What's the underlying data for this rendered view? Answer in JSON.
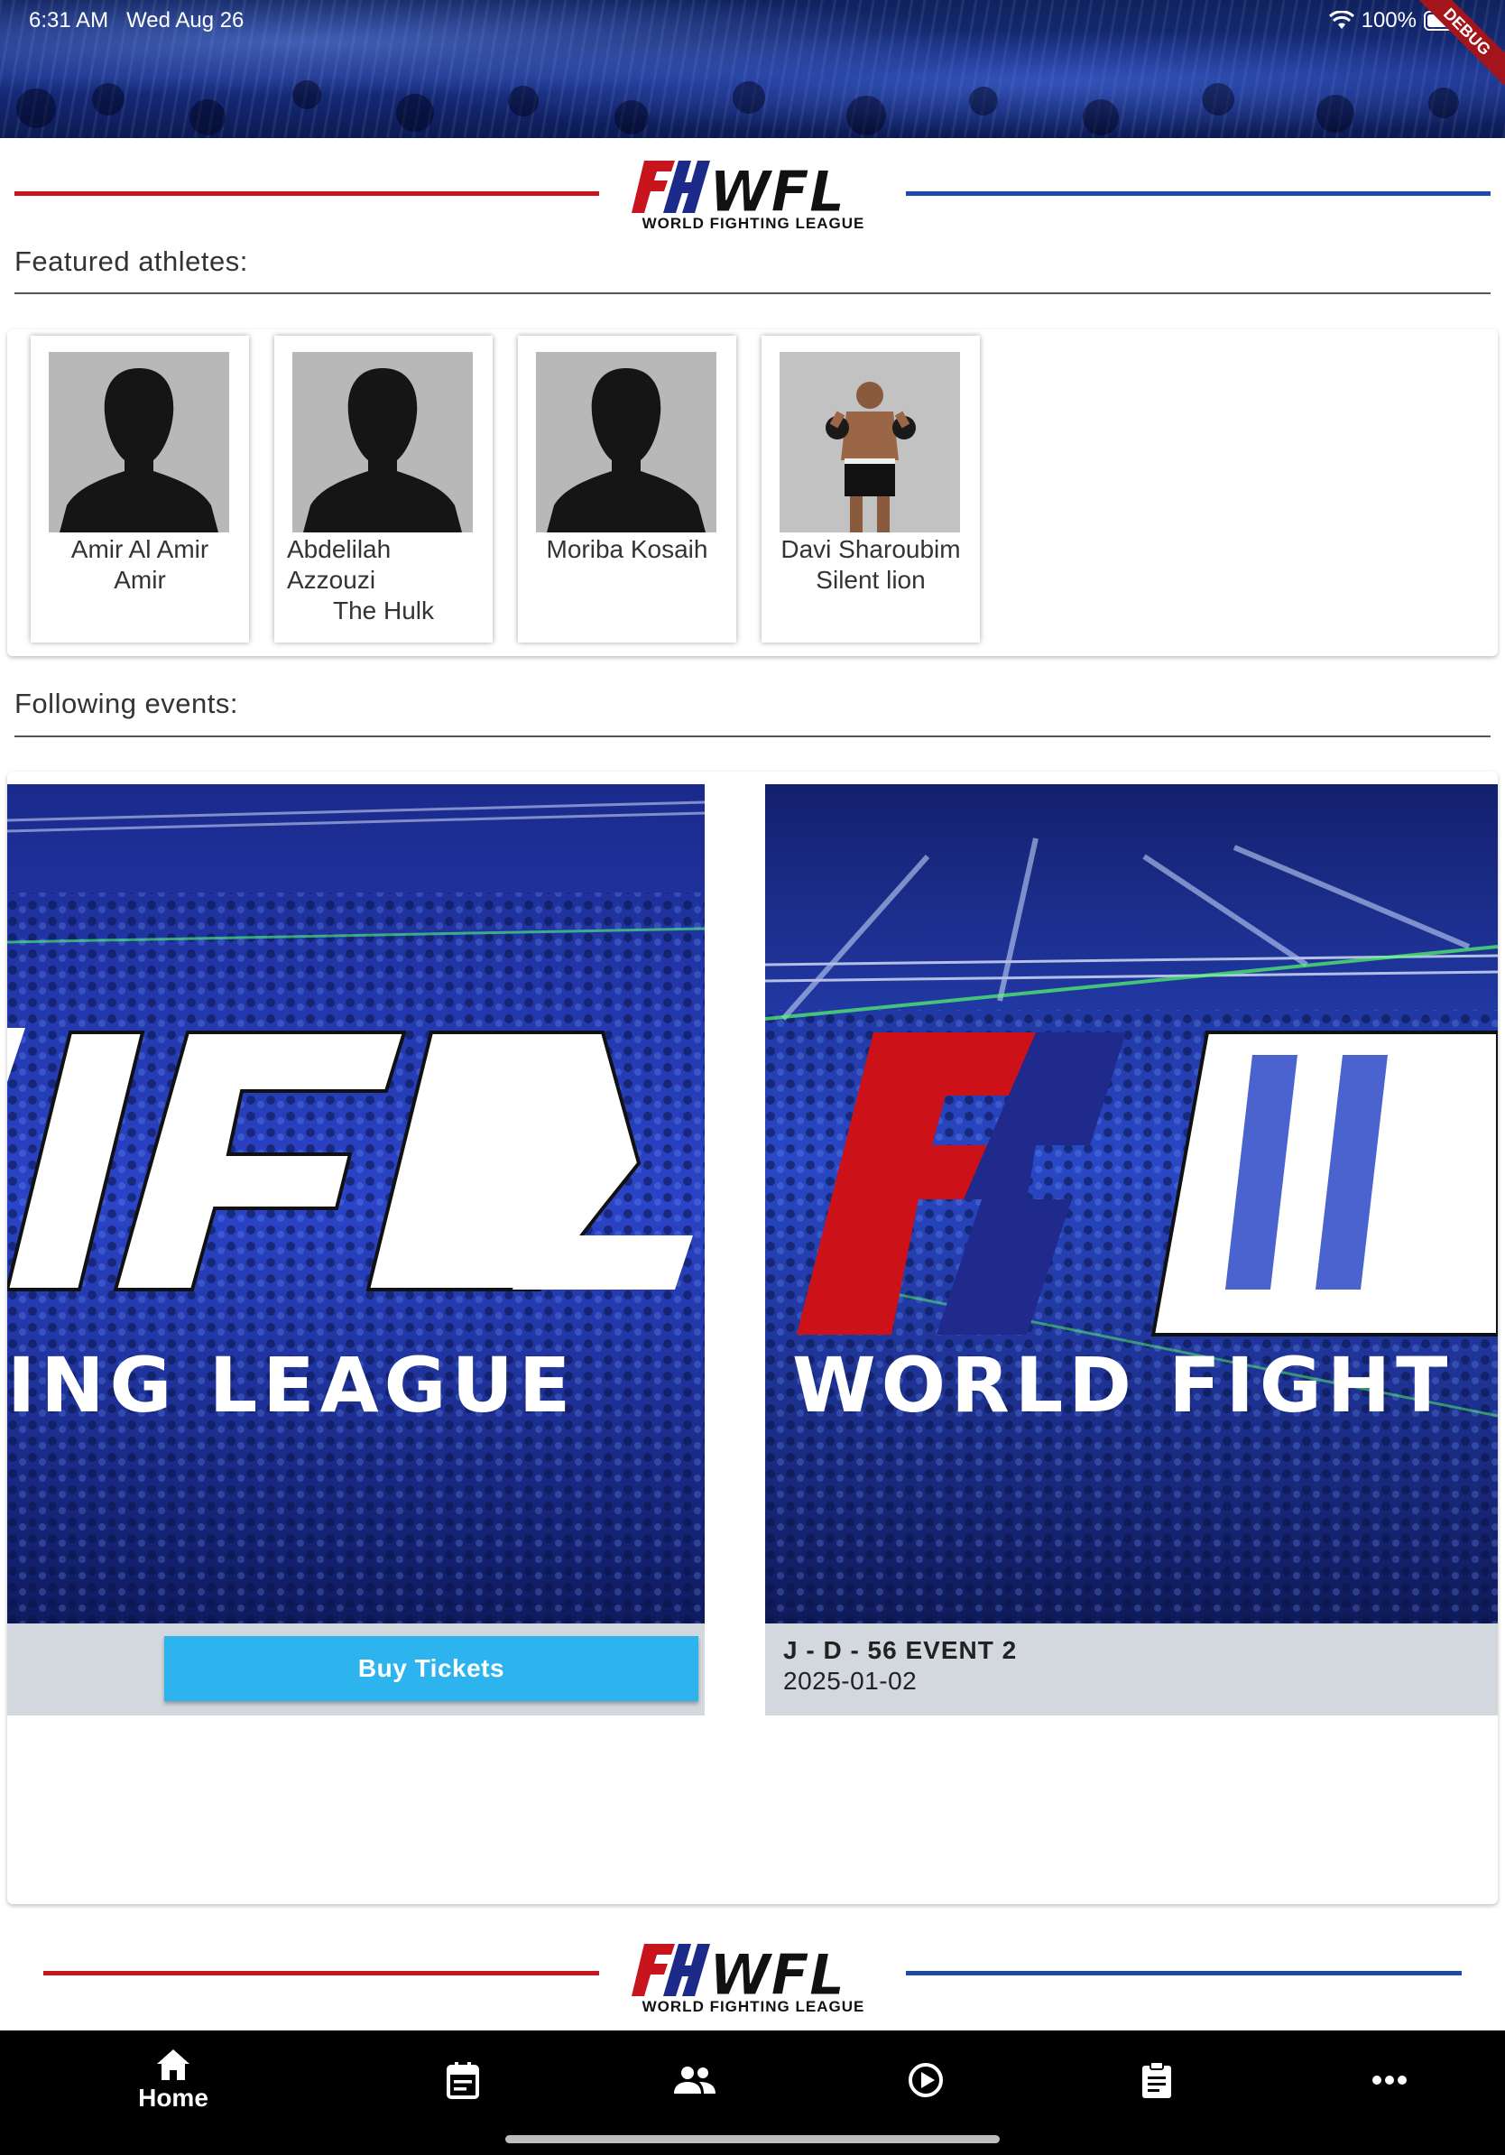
{
  "status_bar": {
    "time": "6:31 AM",
    "date": "Wed Aug 26",
    "battery": "100%",
    "debug_label": "DEBUG"
  },
  "brand": {
    "logo_text": "FHWFL",
    "logo_subtitle": "WORLD FIGHTING LEAGUE",
    "red": "#c8141c",
    "blue": "#1c4aa8"
  },
  "featured": {
    "title": "Featured athletes:",
    "athletes": [
      {
        "name": "Amir Al Amir Amir",
        "nickname": "",
        "photo": "silhouette"
      },
      {
        "name": "Abdelilah Azzouzi",
        "nickname": "The Hulk",
        "photo": "silhouette"
      },
      {
        "name": "Moriba Kosaih",
        "nickname": "",
        "photo": "silhouette"
      },
      {
        "name": "Davi Sharoubim",
        "nickname": "Silent lion",
        "photo": "fighter-photo"
      }
    ]
  },
  "events": {
    "title": "Following events:",
    "items": [
      {
        "button_label": "Buy Tickets"
      },
      {
        "name": "J - D - 56 EVENT 2",
        "date": "2025-01-02"
      }
    ],
    "poster_left_text": "ING LEAGUE",
    "poster_right_text": "WORLD FIGHT"
  },
  "nav": {
    "items": [
      {
        "label": "Home",
        "icon": "home-icon",
        "active": true
      },
      {
        "label": "",
        "icon": "calendar-icon"
      },
      {
        "label": "",
        "icon": "people-icon"
      },
      {
        "label": "",
        "icon": "play-circle-icon"
      },
      {
        "label": "",
        "icon": "clipboard-icon"
      },
      {
        "label": "",
        "icon": "more-icon"
      }
    ]
  },
  "colors": {
    "button": "#2db4ef",
    "event_footer": "#d2d8dd",
    "nav_bg": "#000000"
  }
}
